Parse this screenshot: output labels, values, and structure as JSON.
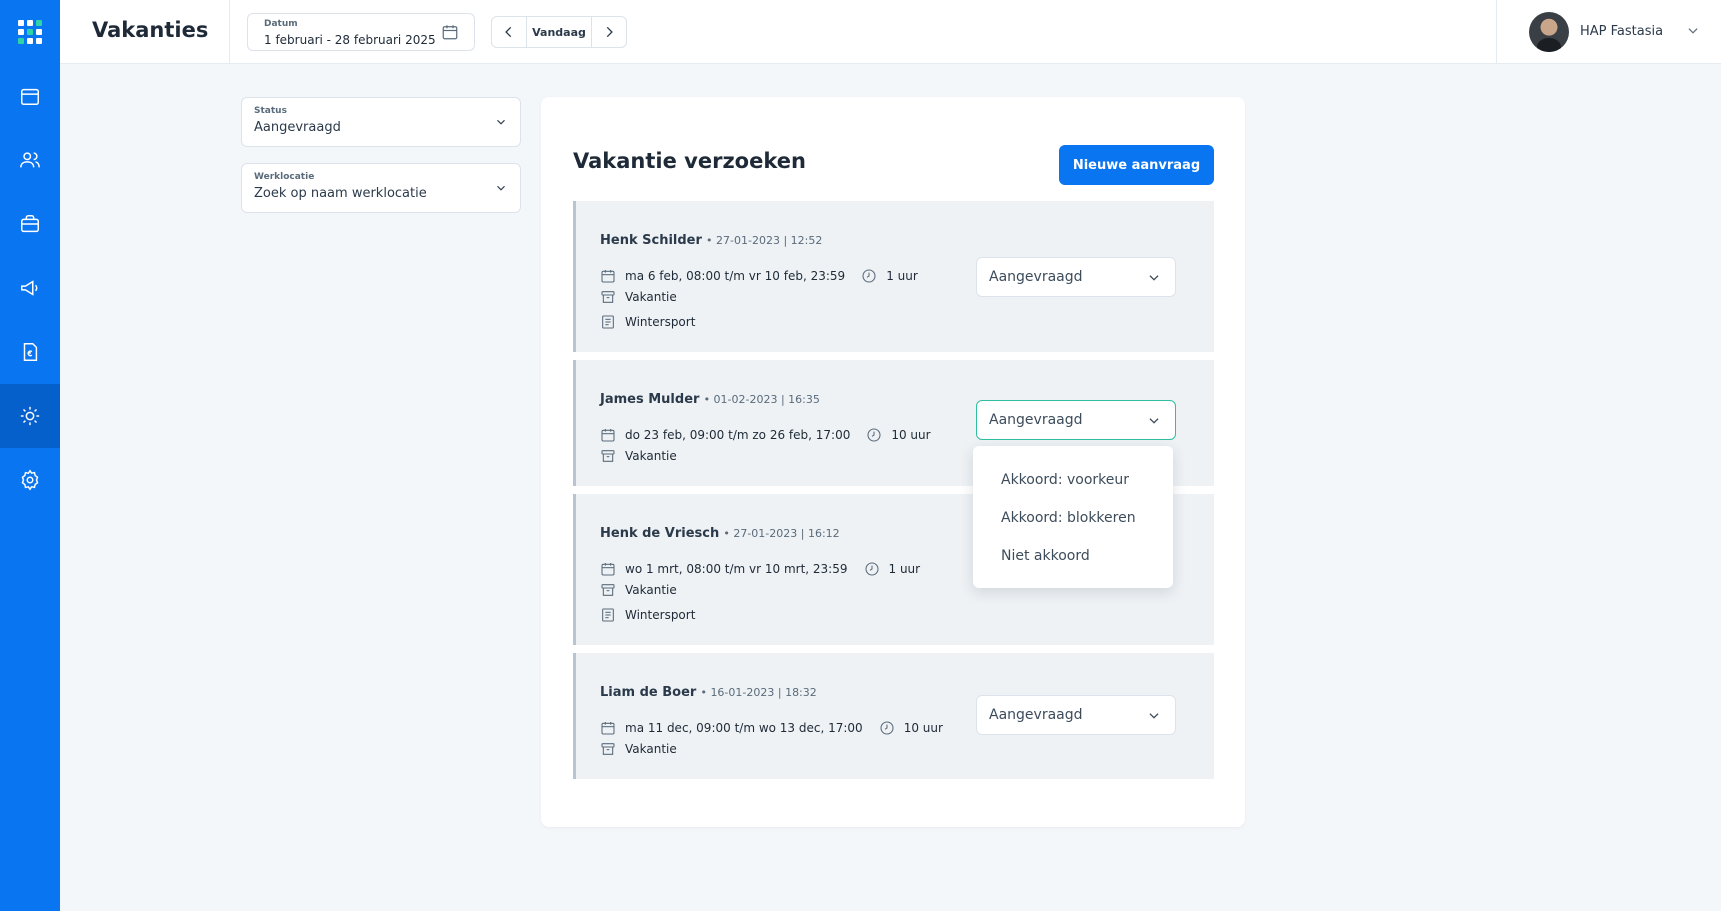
{
  "app": {
    "page_title": "Vakanties"
  },
  "header": {
    "date_label": "Datum",
    "date_value": "1 februari - 28 februari 2025",
    "today_label": "Vandaag",
    "user_name": "HAP Fastasia"
  },
  "sidebar": {
    "items": [
      {
        "icon": "calendar-icon"
      },
      {
        "icon": "users-icon"
      },
      {
        "icon": "briefcase-icon"
      },
      {
        "icon": "megaphone-icon"
      },
      {
        "icon": "invoice-icon"
      },
      {
        "icon": "sun-icon",
        "active": true
      },
      {
        "icon": "gear-icon"
      }
    ]
  },
  "filters": {
    "status_label": "Status",
    "status_value": "Aangevraagd",
    "location_label": "Werklocatie",
    "location_placeholder": "Zoek op naam werklocatie"
  },
  "main": {
    "title": "Vakantie verzoeken",
    "new_button": "Nieuwe aanvraag",
    "requests": [
      {
        "name": "Henk Schilder",
        "meta": "• 27-01-2023 | 12:52",
        "period": "ma 6 feb, 08:00 t/m vr 10 feb, 23:59",
        "hours": "1 uur",
        "type": "Vakantie",
        "note": "Wintersport",
        "status": "Aangevraagd"
      },
      {
        "name": "James Mulder",
        "meta": "• 01-02-2023 | 16:35",
        "period": "do 23 feb, 09:00 t/m zo 26 feb, 17:00",
        "hours": "10 uur",
        "type": "Vakantie",
        "status": "Aangevraagd"
      },
      {
        "name": "Henk de Vriesch",
        "meta": "• 27-01-2023 | 16:12",
        "period": "wo 1 mrt, 08:00 t/m vr 10 mrt, 23:59",
        "hours": "1 uur",
        "type": "Vakantie",
        "note": "Wintersport"
      },
      {
        "name": "Liam de Boer",
        "meta": "• 16-01-2023 | 18:32",
        "period": "ma 11 dec, 09:00 t/m wo 13 dec, 17:00",
        "hours": "10 uur",
        "type": "Vakantie",
        "status": "Aangevraagd"
      }
    ],
    "dropdown_options": [
      "Akkoord: voorkeur",
      "Akkoord: blokkeren",
      "Niet akkoord"
    ]
  },
  "colors": {
    "brand_blue": "#0a75f0",
    "focus_teal": "#2fbfa0"
  }
}
